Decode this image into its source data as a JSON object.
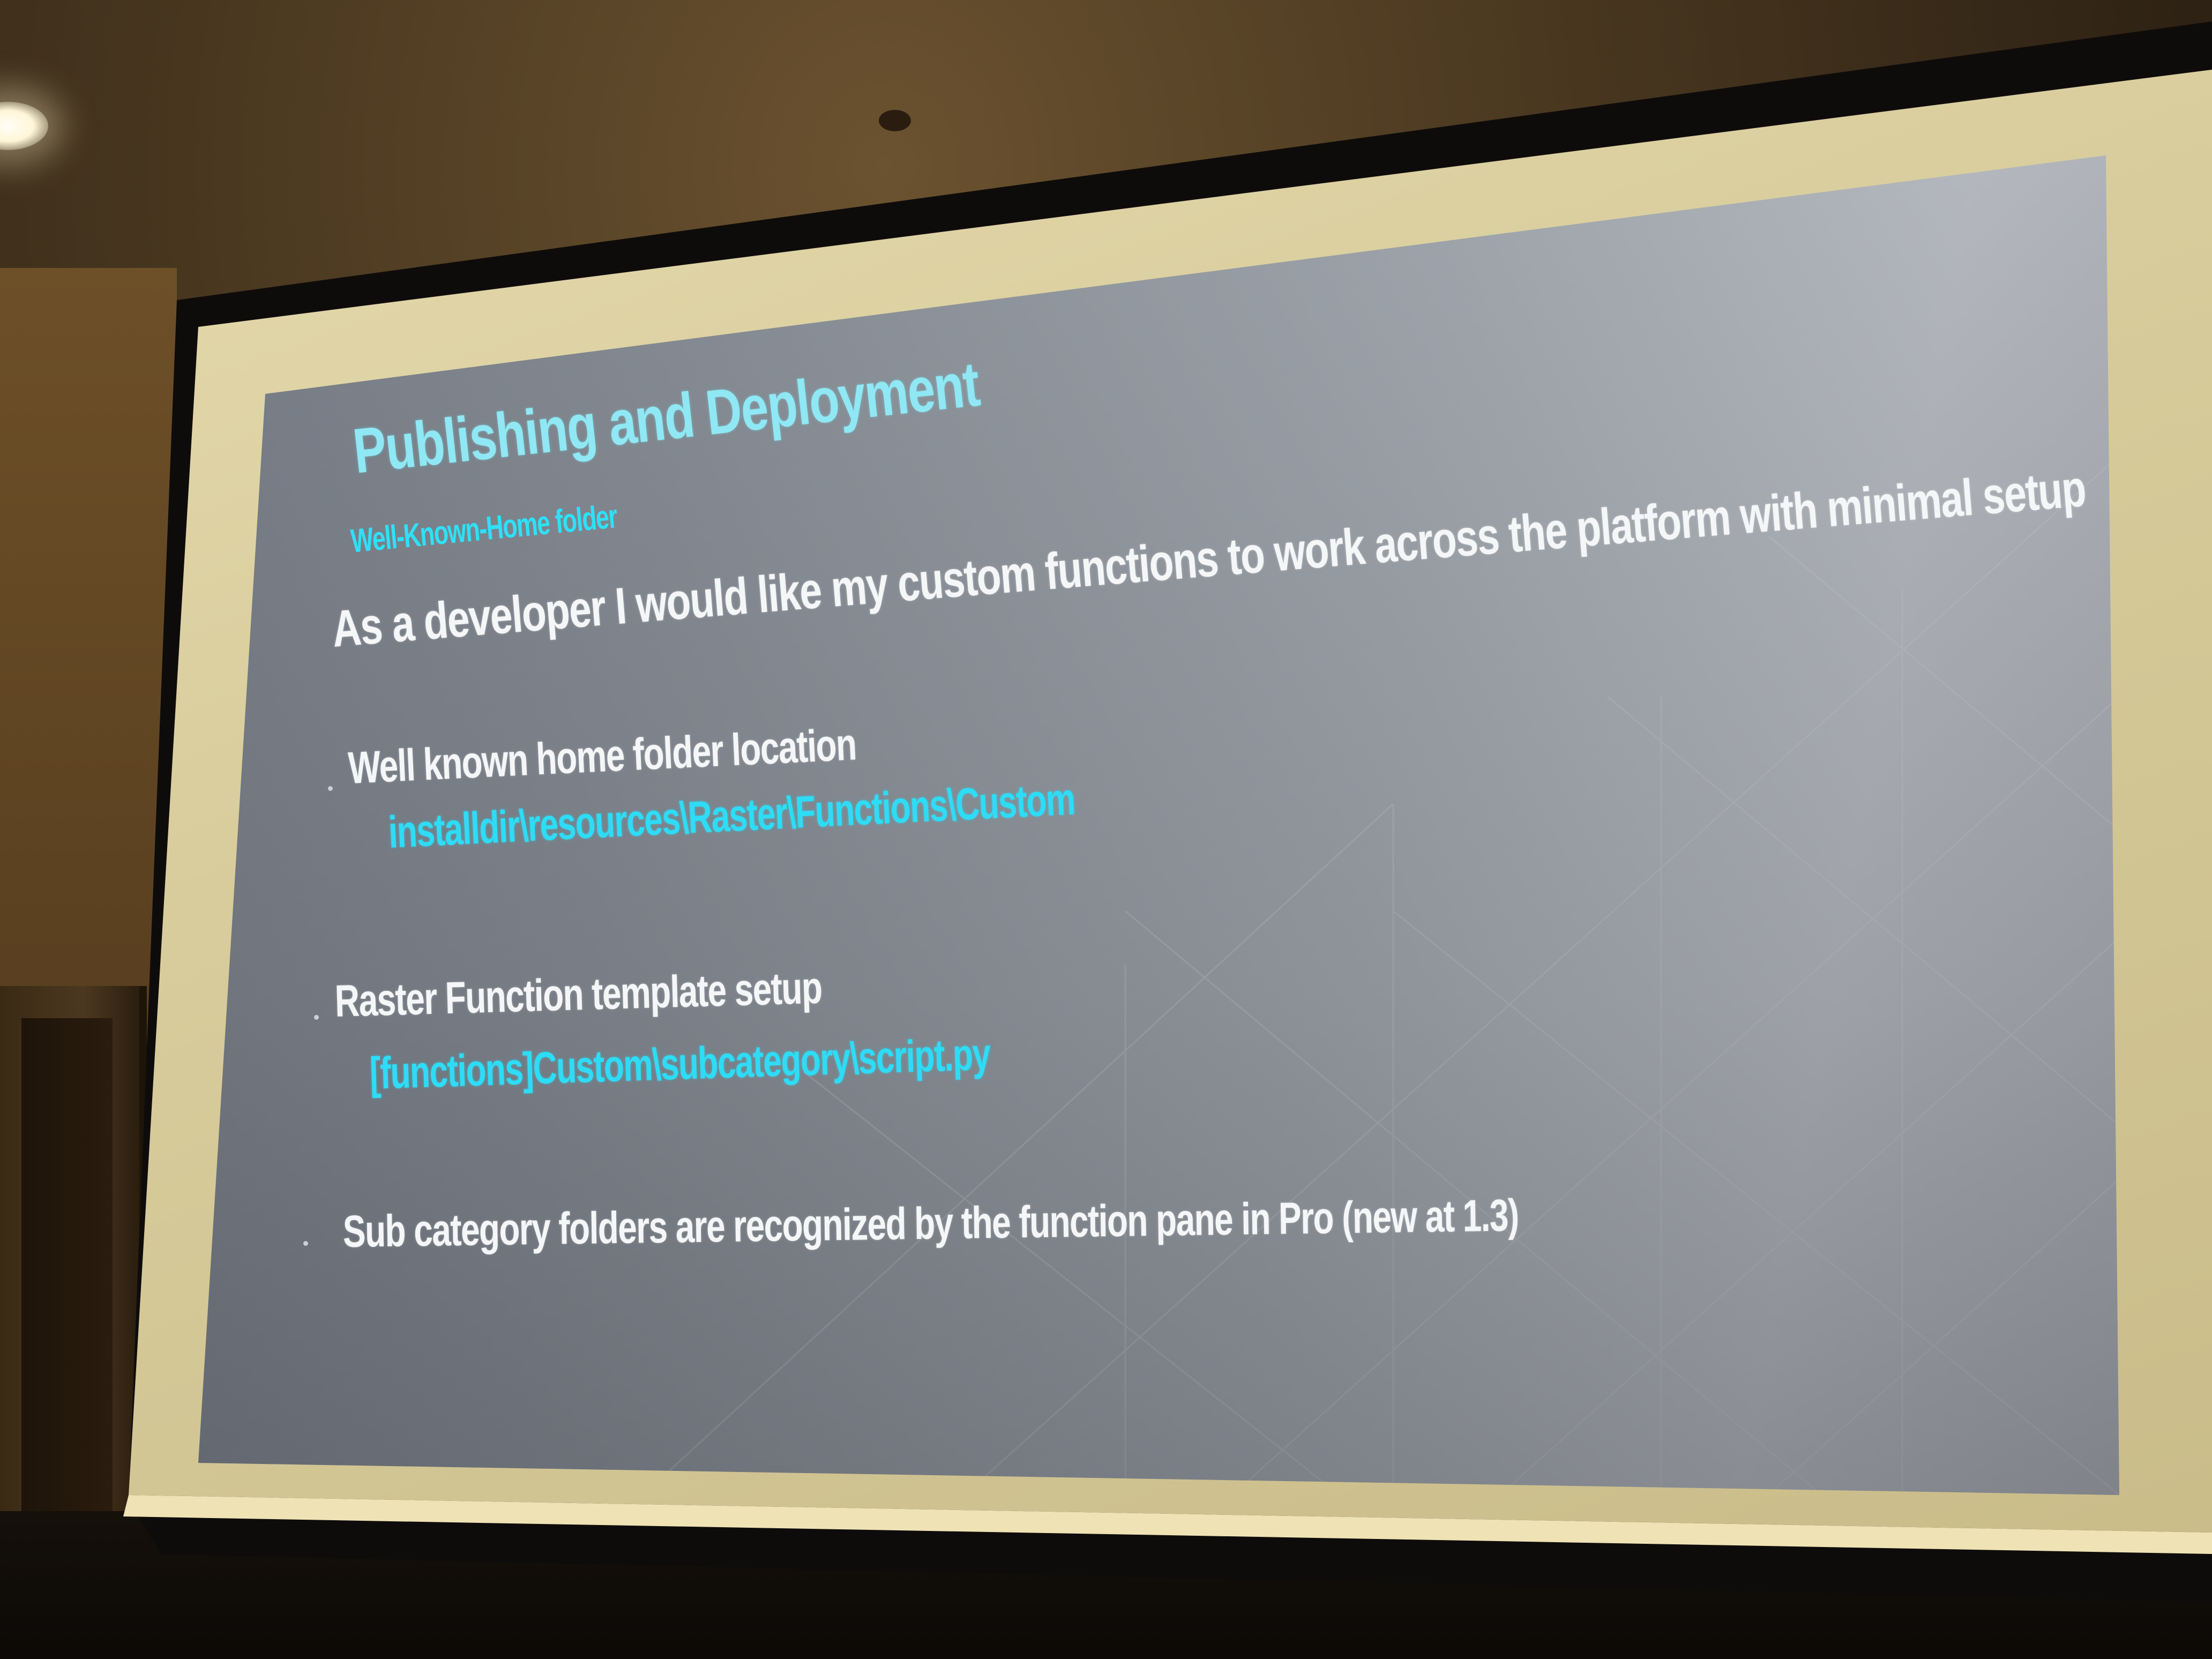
{
  "slide": {
    "title": "Publishing and Deployment",
    "subtitle": "Well-Known-Home folder",
    "lead": "As  a developer I would like my custom functions to work across the platform with minimal setup",
    "bullets": [
      {
        "text": "Well known home folder location",
        "path": "installdir\\resources\\Raster\\Functions\\Custom"
      },
      {
        "text": "Raster Function template setup",
        "path": "[functions]Custom\\subcategory\\script.py"
      },
      {
        "text": "Sub category folders are recognized  by the function pane in Pro (new at 1.3)"
      }
    ]
  },
  "colors": {
    "title": "#8fe8f4",
    "accent": "#2edcf6",
    "body_text": "#f4f6f8",
    "slide_background": "#9aa0a8",
    "screen_border": "#d8cc9c"
  }
}
